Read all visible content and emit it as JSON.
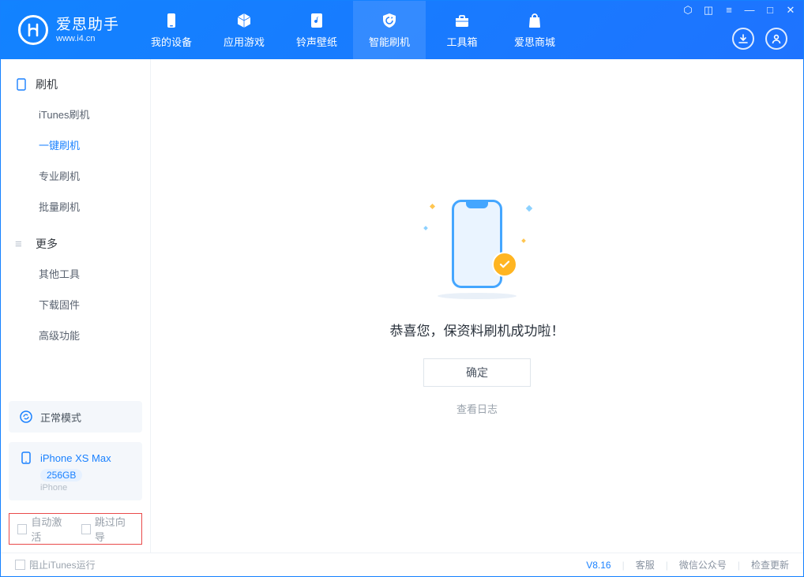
{
  "app": {
    "title": "爱思助手",
    "subtitle": "www.i4.cn"
  },
  "tabs": [
    {
      "label": "我的设备",
      "icon": "device-icon"
    },
    {
      "label": "应用游戏",
      "icon": "cube-icon"
    },
    {
      "label": "铃声壁纸",
      "icon": "music-file-icon"
    },
    {
      "label": "智能刷机",
      "icon": "shield-refresh-icon"
    },
    {
      "label": "工具箱",
      "icon": "toolbox-icon"
    },
    {
      "label": "爱思商城",
      "icon": "bag-icon"
    }
  ],
  "sidebar": {
    "section1": {
      "title": "刷机"
    },
    "items1": [
      {
        "label": "iTunes刷机"
      },
      {
        "label": "一键刷机"
      },
      {
        "label": "专业刷机"
      },
      {
        "label": "批量刷机"
      }
    ],
    "section2": {
      "title": "更多"
    },
    "items2": [
      {
        "label": "其他工具"
      },
      {
        "label": "下载固件"
      },
      {
        "label": "高级功能"
      }
    ],
    "mode_card": {
      "label": "正常模式"
    },
    "device_card": {
      "name": "iPhone XS Max",
      "capacity": "256GB",
      "type": "iPhone"
    },
    "opts": {
      "auto_activate": "自动激活",
      "skip_guide": "跳过向导"
    }
  },
  "main": {
    "success": "恭喜您，保资料刷机成功啦！",
    "ok": "确定",
    "view_log": "查看日志"
  },
  "footer": {
    "block_itunes": "阻止iTunes运行",
    "version": "V8.16",
    "links": [
      "客服",
      "微信公众号",
      "检查更新"
    ]
  }
}
